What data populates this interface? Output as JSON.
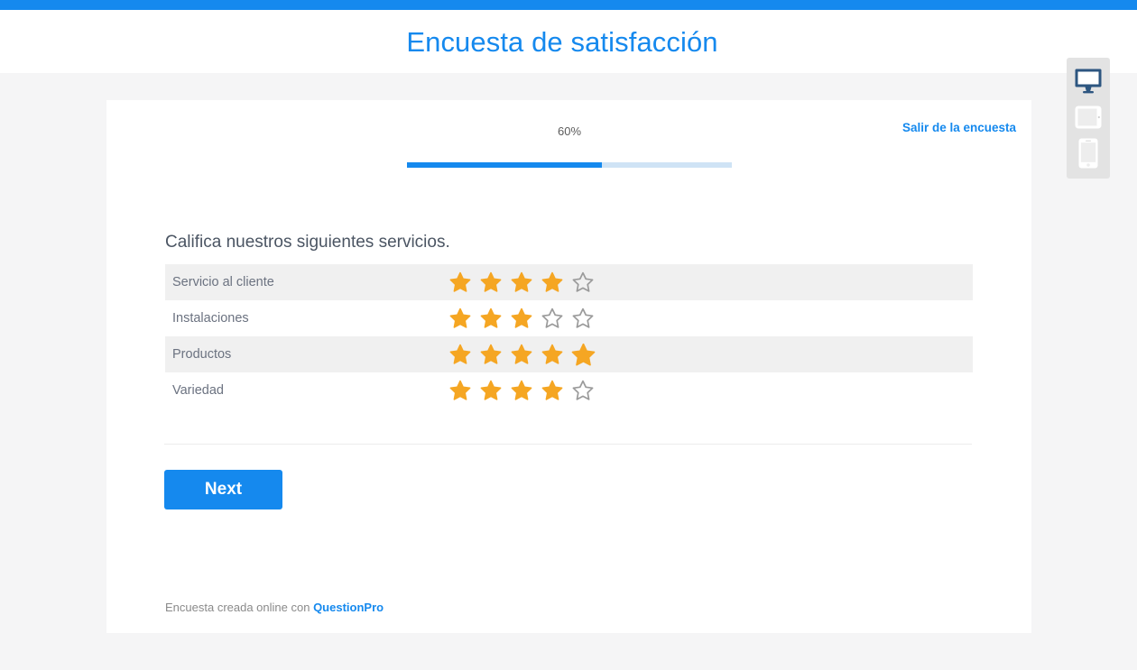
{
  "header": {
    "title": "Encuesta de satisfacción"
  },
  "colors": {
    "brand_blue": "#1589ee",
    "star_filled": "#f5a623",
    "star_empty": "#9a9a9a",
    "device_active": "#2d5680",
    "stripe": "#f0f0f0"
  },
  "progress": {
    "percent_label": "60%",
    "percent_value": 60
  },
  "exit": {
    "label": "Salir de la encuesta"
  },
  "question": {
    "title": "Califica nuestros siguientes servicios.",
    "max_stars": 5,
    "rows": [
      {
        "label": "Servicio al cliente",
        "rating": 4
      },
      {
        "label": "Instalaciones",
        "rating": 3
      },
      {
        "label": "Productos",
        "rating": 5
      },
      {
        "label": "Variedad",
        "rating": 4
      }
    ]
  },
  "actions": {
    "next_label": "Next"
  },
  "footer": {
    "text": "Encuesta creada online con ",
    "brand": "QuestionPro"
  },
  "device_switcher": {
    "items": [
      {
        "name": "desktop-view-button",
        "icon": "desktop-icon",
        "active": true
      },
      {
        "name": "tablet-view-button",
        "icon": "tablet-icon",
        "active": false
      },
      {
        "name": "mobile-view-button",
        "icon": "mobile-icon",
        "active": false
      }
    ]
  }
}
